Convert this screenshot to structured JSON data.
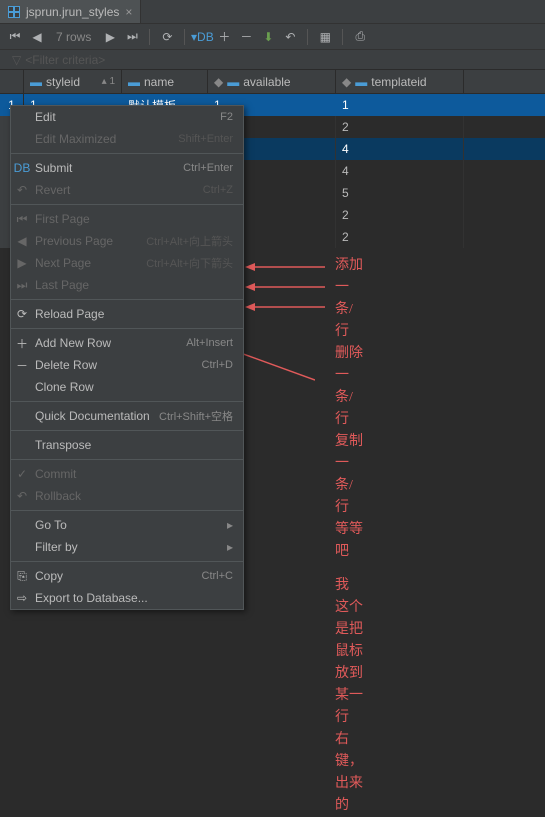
{
  "tab": {
    "label": "jsprun.jrun_styles"
  },
  "toolbar": {
    "rows": "7 rows"
  },
  "filter": {
    "placeholder": "<Filter criteria>"
  },
  "columns": {
    "styleid": "styleid",
    "name": "name",
    "available": "available",
    "templateid": "templateid",
    "sort1": "1"
  },
  "rows": [
    {
      "n": "1",
      "styleid": "1",
      "name": "默认模板",
      "available": "1",
      "templateid": "1"
    },
    {
      "n": "",
      "styleid": "",
      "name": "",
      "available": "",
      "templateid": "2"
    },
    {
      "n": "",
      "styleid": "",
      "name": "",
      "available": "",
      "templateid": "4"
    },
    {
      "n": "",
      "styleid": "",
      "name": "",
      "available": "",
      "templateid": "4"
    },
    {
      "n": "",
      "styleid": "",
      "name": "",
      "available": "",
      "templateid": "5"
    },
    {
      "n": "",
      "styleid": "",
      "name": "",
      "available": "",
      "templateid": "2"
    },
    {
      "n": "",
      "styleid": "",
      "name": "",
      "available": "",
      "templateid": "2"
    }
  ],
  "menu": {
    "edit": "Edit",
    "edit_sc": "F2",
    "editmax": "Edit Maximized",
    "editmax_sc": "Shift+Enter",
    "submit": "Submit",
    "submit_sc": "Ctrl+Enter",
    "revert": "Revert",
    "revert_sc": "Ctrl+Z",
    "first": "First Page",
    "prev": "Previous Page",
    "prev_sc": "Ctrl+Alt+向上箭头",
    "next": "Next Page",
    "next_sc": "Ctrl+Alt+向下箭头",
    "last": "Last Page",
    "reload": "Reload Page",
    "add": "Add New Row",
    "add_sc": "Alt+Insert",
    "del": "Delete Row",
    "del_sc": "Ctrl+D",
    "clone": "Clone Row",
    "quickdoc": "Quick Documentation",
    "quickdoc_sc": "Ctrl+Shift+空格",
    "transpose": "Transpose",
    "commit": "Commit",
    "rollback": "Rollback",
    "goto": "Go To",
    "filterby": "Filter by",
    "copy": "Copy",
    "copy_sc": "Ctrl+C",
    "export": "Export to Database..."
  },
  "anno": {
    "l1": "添加一条/行",
    "l2": "删除一条/行",
    "l3": "复制一条/行",
    "l4": "等等吧",
    "l5": "我 这个是把鼠标放到某一行",
    "l6": "右键，出来的"
  }
}
